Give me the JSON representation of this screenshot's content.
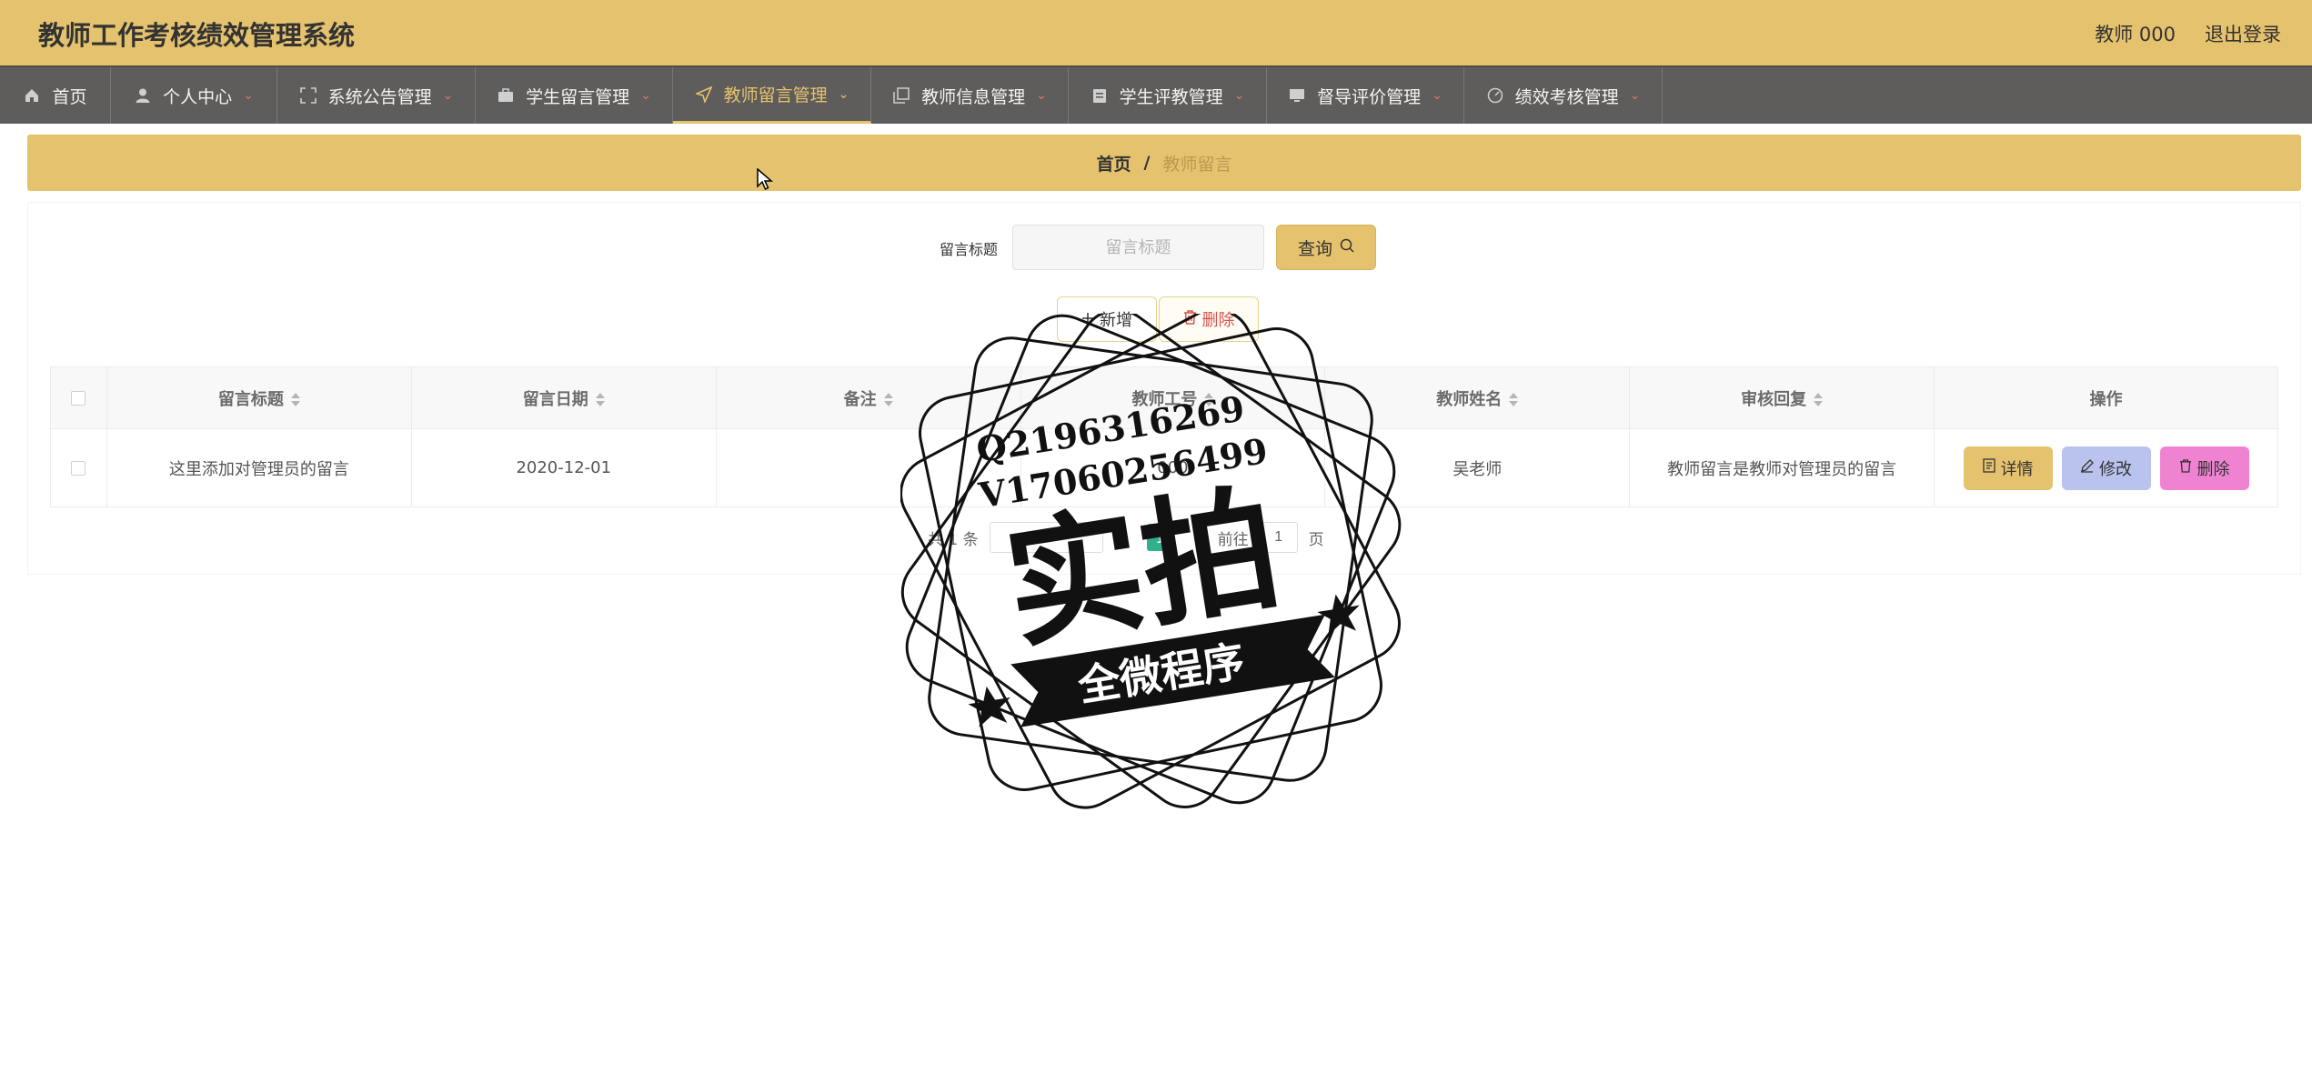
{
  "app": {
    "title": "教师工作考核绩效管理系统",
    "user_label": "教师 000",
    "logout_label": "退出登录"
  },
  "nav": {
    "items": [
      {
        "label": "首页",
        "icon": "home-icon"
      },
      {
        "label": "个人中心",
        "icon": "user-icon"
      },
      {
        "label": "系统公告管理",
        "icon": "expand-icon"
      },
      {
        "label": "学生留言管理",
        "icon": "briefcase-icon"
      },
      {
        "label": "教师留言管理",
        "icon": "send-icon",
        "active": true
      },
      {
        "label": "教师信息管理",
        "icon": "copy-icon"
      },
      {
        "label": "学生评教管理",
        "icon": "clipboard-icon"
      },
      {
        "label": "督导评价管理",
        "icon": "monitor-icon"
      },
      {
        "label": "绩效考核管理",
        "icon": "gauge-icon"
      }
    ]
  },
  "breadcrumb": {
    "home": "首页",
    "separator": "/",
    "current": "教师留言"
  },
  "search": {
    "label": "留言标题",
    "placeholder": "留言标题",
    "value": "",
    "button_label": "查询"
  },
  "actions": {
    "add_label": "新增",
    "delete_label": "删除"
  },
  "table": {
    "columns": [
      "留言标题",
      "留言日期",
      "备注",
      "教师工号",
      "教师姓名",
      "审核回复",
      "操作"
    ],
    "rows": [
      {
        "title": "这里添加对管理员的留言",
        "date": "2020-12-01",
        "remark": "",
        "teacher_no": "000",
        "teacher_name": "吴老师",
        "reply": "教师留言是教师对管理员的留言"
      }
    ],
    "row_actions": {
      "detail": "详情",
      "edit": "修改",
      "delete": "删除"
    }
  },
  "pagination": {
    "total_prefix": "共",
    "total": "1",
    "total_suffix": "条",
    "current_page": "1",
    "goto_prefix": "前往",
    "goto_value": "1",
    "goto_suffix": "页"
  },
  "watermark": {
    "lines": [
      "Q2196316269",
      "V17060256499"
    ],
    "main": "实拍",
    "banner": "全微程序"
  },
  "colors": {
    "accent": "#e5c26d",
    "nav_bg": "#5f5d5b",
    "edit_btn": "#b9c3ee",
    "delete_btn": "#f083d1",
    "page_active": "#30b08f"
  }
}
